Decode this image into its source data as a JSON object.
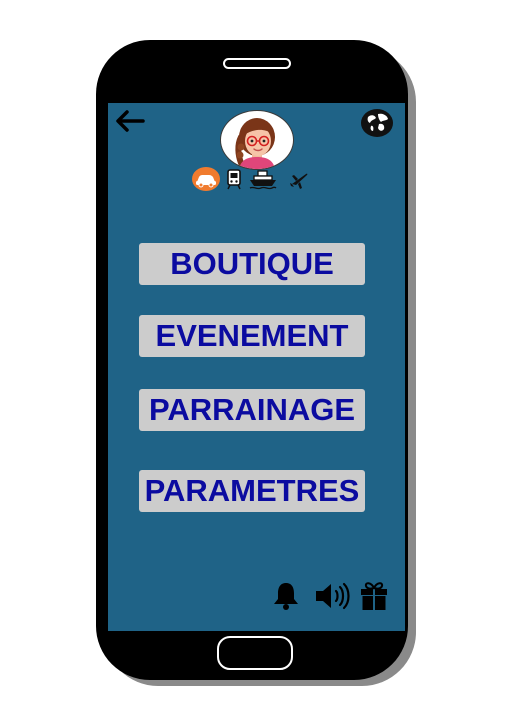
{
  "menu": {
    "items": [
      {
        "label": "BOUTIQUE"
      },
      {
        "label": "EVENEMENT"
      },
      {
        "label": "PARRAINAGE"
      },
      {
        "label": "PARAMETRES"
      }
    ]
  },
  "top_bar": {
    "back_icon": "arrow-left-icon",
    "language_icon": "globe-icon",
    "avatar_icon": "user-avatar"
  },
  "transport_modes": [
    {
      "icon": "car-icon",
      "selected": true
    },
    {
      "icon": "train-icon",
      "selected": false
    },
    {
      "icon": "ship-icon",
      "selected": false
    },
    {
      "icon": "plane-icon",
      "selected": false
    }
  ],
  "bottom_bar": {
    "icons": [
      "bell-icon",
      "speaker-icon",
      "gift-icon"
    ]
  },
  "colors": {
    "screen_background": "#1f6387",
    "button_background": "#cccccc",
    "button_text": "#0b0ba0",
    "selected_transport": "#f07b2e",
    "phone_body": "#000000"
  }
}
